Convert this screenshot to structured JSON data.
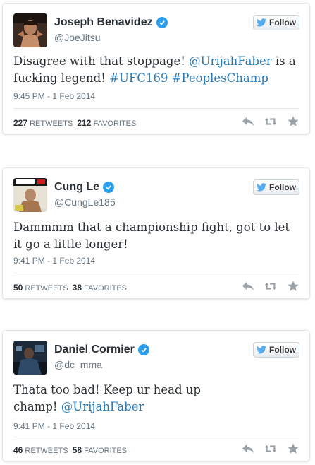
{
  "tweets": [
    {
      "name": "Joseph Benavidez",
      "handle": "@JoeJitsu",
      "follow_label": "Follow",
      "text_parts": [
        "Disagree with that stoppage! ",
        "@UrijahFaber",
        " is a fucking legend! ",
        "#UFC169",
        " ",
        "#PeoplesChamp"
      ],
      "time": "9:45 PM - 1 Feb 2014",
      "retweets": "227",
      "retweets_label": "RETWEETS",
      "favorites": "212",
      "favorites_label": "FAVORITES"
    },
    {
      "name": "Cung Le",
      "handle": "@CungLe185",
      "follow_label": "Follow",
      "text": "Dammmm that a championship fight, got to let it go a little longer!",
      "time": "9:41 PM - 1 Feb 2014",
      "retweets": "50",
      "retweets_label": "RETWEETS",
      "favorites": "38",
      "favorites_label": "FAVORITES"
    },
    {
      "name": "Daniel Cormier",
      "handle": "@dc_mma",
      "follow_label": "Follow",
      "text_parts": [
        "Thata too bad! Keep ur head up champ! ",
        "@UrijahFaber"
      ],
      "time": "9:41 PM - 1 Feb 2014",
      "retweets": "46",
      "retweets_label": "RETWEETS",
      "favorites": "58",
      "favorites_label": "FAVORITES"
    }
  ],
  "colors": {
    "link": "#2b7bb9",
    "verified": "#2b9ded",
    "twitter_bird": "#55acee",
    "icon_gray": "#99a0a6"
  },
  "icons": [
    "verified-badge-icon",
    "twitter-bird-icon",
    "reply-icon",
    "retweet-icon",
    "favorite-star-icon"
  ]
}
